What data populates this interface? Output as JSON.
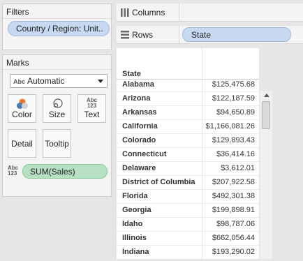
{
  "filters": {
    "title": "Filters",
    "pill": "Country / Region: Unit.."
  },
  "marks": {
    "title": "Marks",
    "mark_type": "Automatic",
    "mark_type_prefix": "Abc",
    "buttons": {
      "color": "Color",
      "size": "Size",
      "text": "Text",
      "detail": "Detail",
      "tooltip": "Tooltip"
    },
    "text_icon_top": "Abc",
    "text_icon_bottom": "123",
    "sum_pill": "SUM(Sales)",
    "sum_icon_top": "Abc",
    "sum_icon_bottom": "123"
  },
  "shelves": {
    "columns_label": "Columns",
    "rows_label": "Rows",
    "rows_pill": "State"
  },
  "table": {
    "header": "State",
    "rows": [
      {
        "state": "Alabama",
        "value": "$125,475.68"
      },
      {
        "state": "Arizona",
        "value": "$122,187.59"
      },
      {
        "state": "Arkansas",
        "value": "$94,650.89"
      },
      {
        "state": "California",
        "value": "$1,166,081.26"
      },
      {
        "state": "Colorado",
        "value": "$129,893.43"
      },
      {
        "state": "Connecticut",
        "value": "$36,414.16"
      },
      {
        "state": "Delaware",
        "value": "$3,612.01"
      },
      {
        "state": "District of Columbia",
        "value": "$207,922.58"
      },
      {
        "state": "Florida",
        "value": "$492,301.38"
      },
      {
        "state": "Georgia",
        "value": "$199,898.91"
      },
      {
        "state": "Idaho",
        "value": "$98,787.06"
      },
      {
        "state": "Illinois",
        "value": "$662,056.44"
      },
      {
        "state": "Indiana",
        "value": "$193,290.02"
      }
    ]
  },
  "colors": {
    "dimension_pill": "#c6d9f1",
    "measure_pill": "#b7e0c3"
  }
}
